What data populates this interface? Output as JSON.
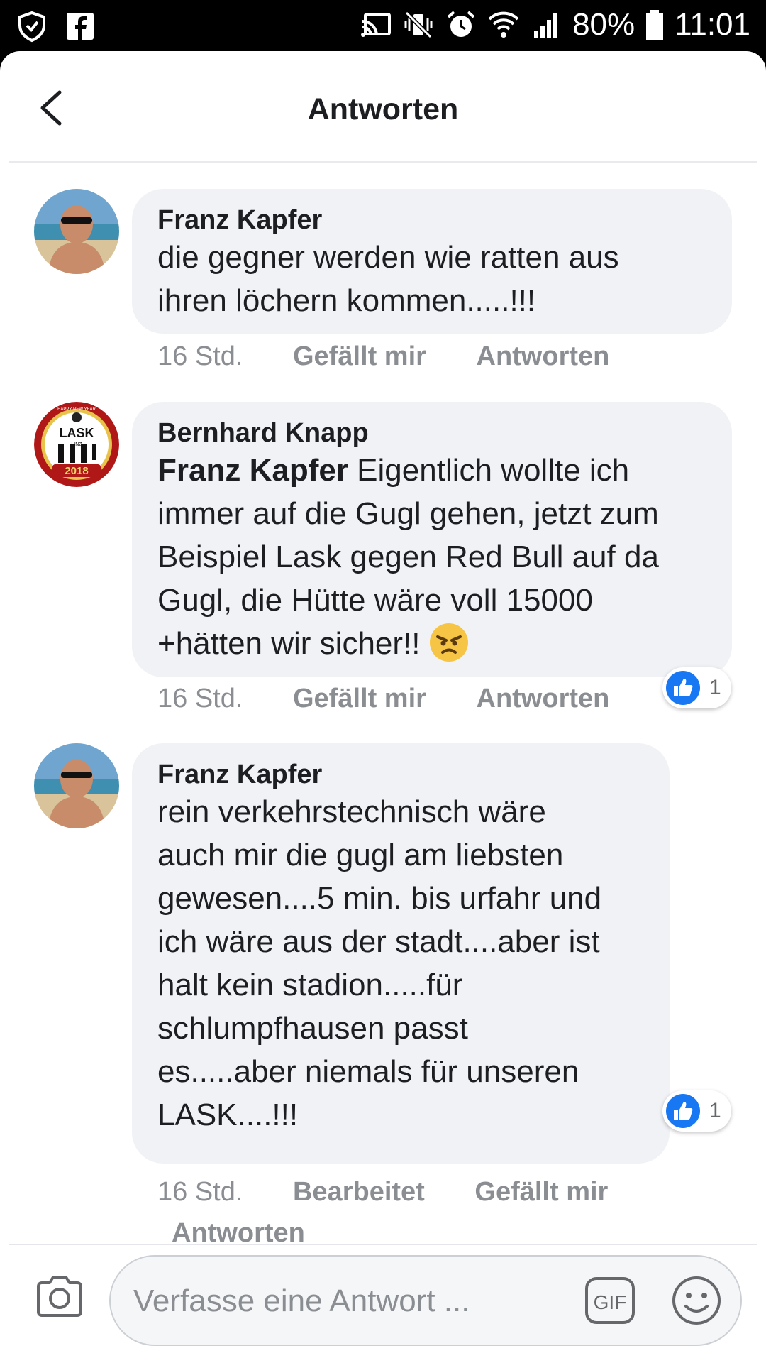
{
  "status_bar": {
    "battery": "80%",
    "time": "11:01"
  },
  "header": {
    "title": "Antworten"
  },
  "comments": [
    {
      "author": "Franz Kapfer",
      "text_lines": [
        "die gegner werden wie ratten aus",
        "ihren löchern kommen.....!!!"
      ],
      "time": "16 Std.",
      "actions": [
        "Gefällt mir",
        "Antworten"
      ]
    },
    {
      "author": "Bernhard Knapp",
      "mention": "Franz Kapfer",
      "first_line_rest": " Eigentlich wollte ich",
      "text_lines": [
        "immer auf die Gugl gehen, jetzt zum",
        "Beispiel Lask gegen Red Bull auf da",
        "Gugl, die Hütte wäre voll 15000",
        "+hätten wir sicher!! "
      ],
      "time": "16 Std.",
      "actions": [
        "Gefällt mir",
        "Antworten"
      ],
      "likes": "1",
      "avatar_label": "LASK",
      "avatar_sub": "LINZ",
      "avatar_year": "2018",
      "avatar_banner": "HAPPY NEW YEAR"
    },
    {
      "author": "Franz Kapfer",
      "text_lines": [
        "rein verkehrstechnisch wäre",
        "auch mir die gugl am liebsten",
        "gewesen....5 min. bis urfahr und",
        "ich wäre aus der stadt....aber ist",
        "halt kein stadion.....für",
        "schlumpfhausen passt",
        "es.....aber niemals für unseren",
        "LASK....!!!"
      ],
      "time": "16 Std.",
      "edited": "Bearbeitet",
      "actions": [
        "Gefällt mir",
        "Antworten"
      ],
      "likes": "1"
    }
  ],
  "composer": {
    "placeholder": "Verfasse eine Antwort ...",
    "gif_label": "GIF"
  },
  "colors": {
    "bubble": "#f0f2f5",
    "like_blue": "#1877f2",
    "muted": "#8a8d91",
    "status_bar": "#000000"
  },
  "icons": [
    "shield-icon",
    "facebook-icon",
    "cast-icon",
    "vibrate-icon",
    "alarm-icon",
    "wifi-icon",
    "signal-icon",
    "battery-icon",
    "back-arrow-icon",
    "angry-emoji-icon",
    "like-thumb-icon",
    "camera-icon",
    "gif-icon",
    "smiley-icon"
  ]
}
